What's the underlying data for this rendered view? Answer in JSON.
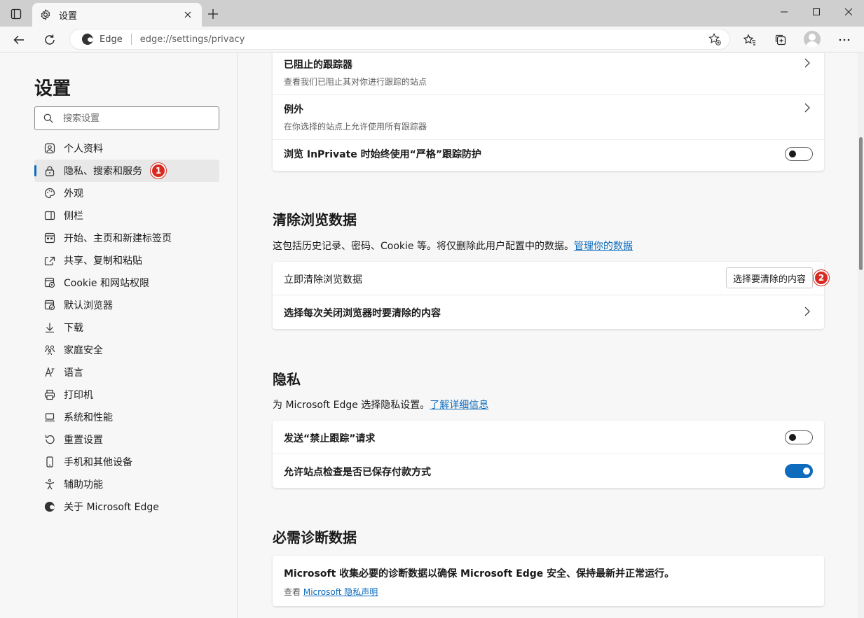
{
  "tab": {
    "title": "设置"
  },
  "address": {
    "site": "Edge",
    "url": "edge://settings/privacy"
  },
  "sidebar": {
    "title": "设置",
    "search_placeholder": "搜索设置",
    "items": [
      {
        "label": "个人资料",
        "icon": "profile-icon"
      },
      {
        "label": "隐私、搜索和服务",
        "icon": "lock-icon",
        "active": true
      },
      {
        "label": "外观",
        "icon": "palette-icon"
      },
      {
        "label": "侧栏",
        "icon": "sidebar-icon"
      },
      {
        "label": "开始、主页和新建标签页",
        "icon": "home-tabs-icon"
      },
      {
        "label": "共享、复制和粘贴",
        "icon": "share-icon"
      },
      {
        "label": "Cookie 和网站权限",
        "icon": "cookie-permissions-icon"
      },
      {
        "label": "默认浏览器",
        "icon": "default-browser-icon"
      },
      {
        "label": "下载",
        "icon": "download-icon"
      },
      {
        "label": "家庭安全",
        "icon": "family-icon"
      },
      {
        "label": "语言",
        "icon": "language-icon"
      },
      {
        "label": "打印机",
        "icon": "printer-icon"
      },
      {
        "label": "系统和性能",
        "icon": "laptop-icon"
      },
      {
        "label": "重置设置",
        "icon": "reset-icon"
      },
      {
        "label": "手机和其他设备",
        "icon": "phone-icon"
      },
      {
        "label": "辅助功能",
        "icon": "accessibility-icon"
      },
      {
        "label": "关于 Microsoft Edge",
        "icon": "edge-logo-icon"
      }
    ]
  },
  "trackers": {
    "blocked_title": "已阻止的跟踪器",
    "blocked_sub": "查看我们已阻止其对你进行跟踪的站点",
    "exceptions_title": "例外",
    "exceptions_sub": "在你选择的站点上允许使用所有跟踪器",
    "inprivate_strict": "浏览 InPrivate 时始终使用“严格”跟踪防护",
    "inprivate_strict_on": false
  },
  "clear_data": {
    "title": "清除浏览数据",
    "desc": "这包括历史记录、密码、Cookie 等。将仅删除此用户配置中的数据。",
    "desc_link": "管理你的数据",
    "clear_now": "立即清除浏览数据",
    "choose_button": "选择要清除的内容",
    "on_close": "选择每次关闭浏览器时要清除的内容"
  },
  "privacy": {
    "title": "隐私",
    "desc": "为 Microsoft Edge 选择隐私设置。",
    "desc_link": "了解详细信息",
    "dnt": "发送“禁止跟踪”请求",
    "dnt_on": false,
    "payment": "允许站点检查是否已保存付款方式",
    "payment_on": true
  },
  "diagnostics": {
    "title": "必需诊断数据",
    "text": "Microsoft 收集必要的诊断数据以确保 Microsoft Edge 安全、保持最新并正常运行。",
    "see": "查看",
    "link": "Microsoft 隐私声明"
  },
  "annotations": {
    "badge1": "1",
    "badge2": "2"
  },
  "colors": {
    "accent": "#0f6cbd",
    "badge": "#d82a20"
  }
}
